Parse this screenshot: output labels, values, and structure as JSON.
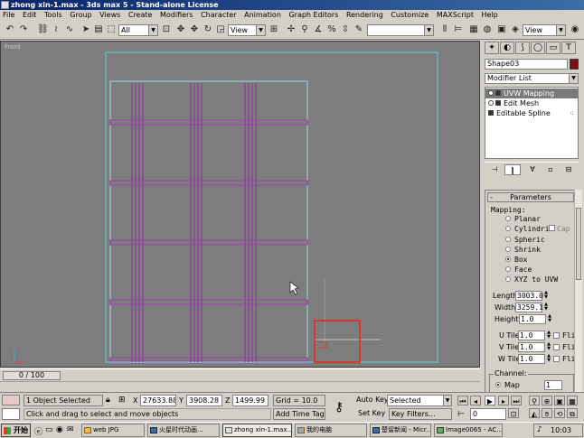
{
  "window": {
    "title": "zhong xin-1.max - 3ds max 5 - Stand-alone License"
  },
  "menu": [
    "File",
    "Edit",
    "Tools",
    "Group",
    "Views",
    "Create",
    "Modifiers",
    "Character",
    "Animation",
    "Graph Editors",
    "Rendering",
    "Customize",
    "MAXScript",
    "Help"
  ],
  "toolbar": {
    "selection_filter": "All",
    "ref_coord": "View",
    "named_selection": "",
    "view_right": "View"
  },
  "viewport": {
    "label": "Front"
  },
  "command_panel": {
    "object_name": "Shape03",
    "object_color": "#7a0f0f",
    "modifier_list": "Modifier List",
    "stack": [
      "UVW Mapping",
      "Edit Mesh",
      "Editable Spline"
    ],
    "rollout_title": "Parameters",
    "mapping_label": "Mapping:",
    "mapping_options": [
      "Planar",
      "Cylindrical",
      "Spherical",
      "Shrink",
      "Box",
      "Face",
      "XYZ to UVW"
    ],
    "cap_label": "Cap",
    "selected_mapping": "Box",
    "length_label": "Length:",
    "length_value": "3003.0",
    "width_label": "Width:",
    "width_value": "3259.1",
    "height_label": "Height:",
    "height_value": "1.0",
    "utile_label": "U Tile:",
    "utile_value": "1.0",
    "vtile_label": "V Tile:",
    "vtile_value": "1.0",
    "wtile_label": "W Tile:",
    "wtile_value": "1.0",
    "flip_label": "Flip",
    "channel_label": "Channel:",
    "channel_option": "Map",
    "channel_value": "1"
  },
  "timeline": {
    "frame": "0 / 100"
  },
  "status": {
    "selected": "1 Object Selected",
    "prompt": "Click and drag to select and move objects",
    "x_label": "X",
    "x_value": "27633.88",
    "y_label": "Y",
    "y_value": "3908.28",
    "z_label": "Z",
    "z_value": "1499.99",
    "grid": "Grid = 10.0",
    "add_time_tag": "Add Time Tag",
    "auto_key": "Auto Key",
    "key_mode": "Selected",
    "set_key": "Set Key",
    "key_filters": "Key Filters...",
    "frame_field": "0"
  },
  "taskbar": {
    "start": "开始",
    "tasks": [
      "web JPG",
      "火星时代动画...",
      "zhong xin-1.max...",
      "我的电脑",
      "楚留新闻 - Micr...",
      "Image0065 - AC..."
    ],
    "clock": "10:03"
  }
}
